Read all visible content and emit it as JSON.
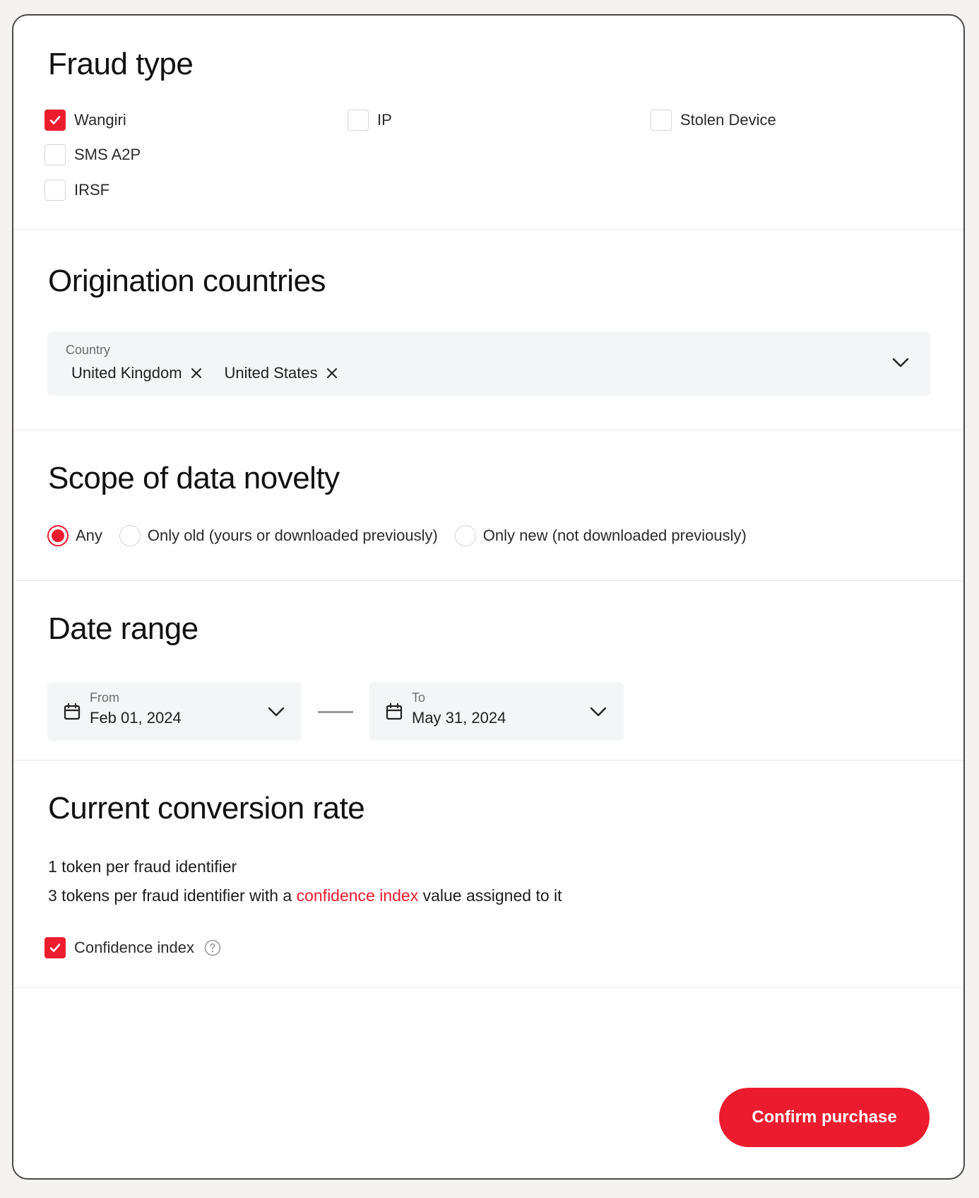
{
  "colors": {
    "accent": "#ec1c2e",
    "card_border": "#4a4a4a",
    "field_bg": "#f4f5f6"
  },
  "fraud_type": {
    "title": "Fraud type",
    "options": [
      {
        "label": "Wangiri",
        "checked": true
      },
      {
        "label": "IP",
        "checked": false
      },
      {
        "label": "Stolen Device",
        "checked": false
      },
      {
        "label": "SMS A2P",
        "checked": false
      },
      {
        "label": "IRSF",
        "checked": false
      }
    ]
  },
  "origination": {
    "title": "Origination countries",
    "caption": "Country",
    "chips": [
      "United Kingdom",
      "United States"
    ],
    "chevron_icon": "chevron-down-icon"
  },
  "scope": {
    "title": "Scope of data novelty",
    "options": [
      {
        "label": "Any",
        "selected": true
      },
      {
        "label": "Only old (yours or downloaded previously)",
        "selected": false
      },
      {
        "label": "Only new (not downloaded previously)",
        "selected": false
      }
    ]
  },
  "date_range": {
    "title": "Date range",
    "from_caption": "From",
    "from_value": "Feb 01, 2024",
    "to_caption": "To",
    "to_value": "May 31, 2024"
  },
  "conversion": {
    "title": "Current conversion rate",
    "line1": "1 token per fraud identifier",
    "line2_prefix": "3 tokens per fraud identifier with a ",
    "line2_link": "confidence index",
    "line2_suffix": " value assigned to it",
    "checkbox_label": "Confidence index",
    "checkbox_checked": true
  },
  "actions": {
    "confirm_label": "Confirm purchase"
  }
}
